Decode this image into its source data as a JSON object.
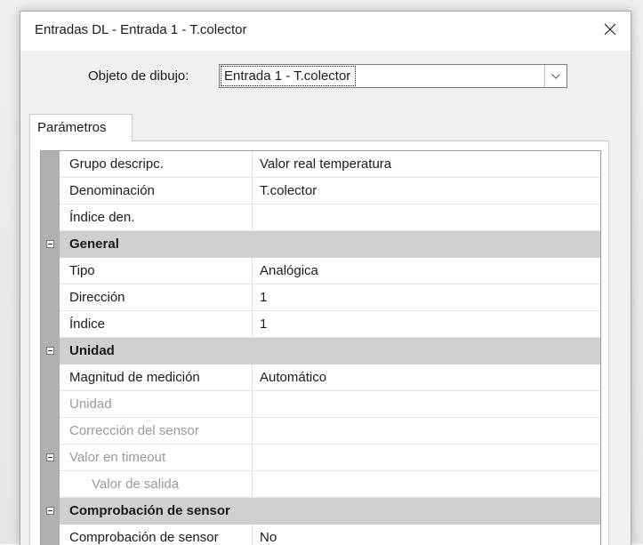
{
  "window": {
    "title": "Entradas DL - Entrada 1 - T.colector"
  },
  "object_selector": {
    "label": "Objeto de dibujo:",
    "value": "Entrada 1 - T.colector"
  },
  "tab": {
    "label": "Parámetros"
  },
  "rows": [
    {
      "name": "Grupo descripc.",
      "value": "Valor real temperatura"
    },
    {
      "name": "Denominación",
      "value": "T.colector"
    },
    {
      "name": "Índice den.",
      "value": ""
    },
    {
      "category": "General"
    },
    {
      "name": "Tipo",
      "value": "Analógica"
    },
    {
      "name": "Dirección",
      "value": "1"
    },
    {
      "name": "Índice",
      "value": "1"
    },
    {
      "category": "Unidad"
    },
    {
      "name": "Magnitud de medición",
      "value": "Automático"
    },
    {
      "name": "Unidad",
      "value": "",
      "disabled": true
    },
    {
      "name": "Corrección del sensor",
      "value": "",
      "disabled": true
    },
    {
      "name": "Valor en timeout",
      "value": "",
      "disabled": true,
      "expander": true
    },
    {
      "name": "Valor de salida",
      "value": "",
      "disabled": true,
      "child": true
    },
    {
      "category": "Comprobación de sensor"
    },
    {
      "name": "Comprobación de sensor",
      "value": "No"
    }
  ]
}
